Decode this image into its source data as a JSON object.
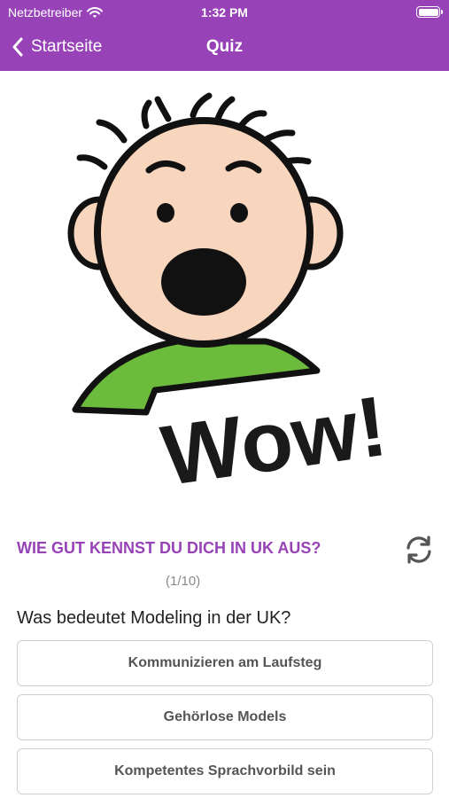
{
  "status_bar": {
    "carrier": "Netzbetreiber",
    "time": "1:32 PM"
  },
  "nav": {
    "back_label": "Startseite",
    "title": "Quiz"
  },
  "hero": {
    "caption": "Wow!"
  },
  "quiz": {
    "heading": "WIE GUT KENNST DU DICH IN UK AUS?",
    "progress": "(1/10)",
    "question": "Was bedeutet Modeling in der UK?",
    "answers": [
      "Kommunizieren am Laufsteg",
      "Gehörlose Models",
      "Kompetentes Sprachvorbild sein"
    ]
  },
  "colors": {
    "accent": "#9743b7",
    "skin": "#f8d5bd",
    "shirt": "#6cbb3c"
  }
}
